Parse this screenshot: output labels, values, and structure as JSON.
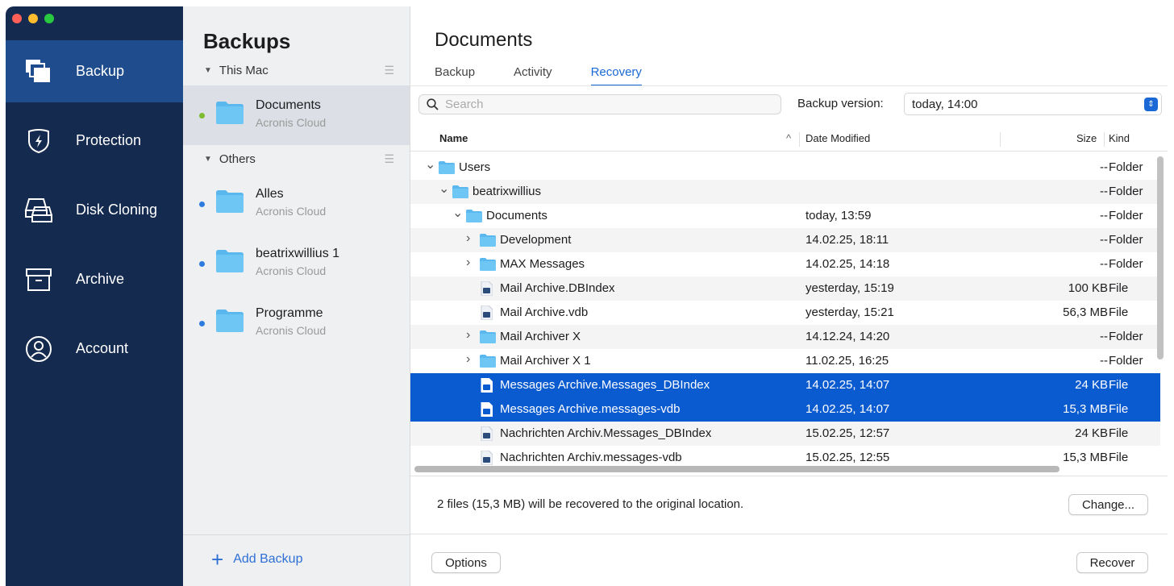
{
  "nav": {
    "items": [
      {
        "label": "Backup",
        "icon": "backup-icon"
      },
      {
        "label": "Protection",
        "icon": "shield-icon"
      },
      {
        "label": "Disk Cloning",
        "icon": "disk-cloning-icon"
      },
      {
        "label": "Archive",
        "icon": "archive-icon"
      },
      {
        "label": "Account",
        "icon": "account-icon"
      }
    ]
  },
  "backups": {
    "title": "Backups",
    "group_this_mac": "This Mac",
    "group_others": "Others",
    "items": [
      {
        "name": "Documents",
        "location": "Acronis Cloud",
        "dot_color": "#7dbb2f"
      },
      {
        "name": "Alles",
        "location": "Acronis Cloud",
        "dot_color": "#2e7be0"
      },
      {
        "name": "beatrixwillius 1",
        "location": "Acronis Cloud",
        "dot_color": "#2e7be0"
      },
      {
        "name": "Programme",
        "location": "Acronis Cloud",
        "dot_color": "#2e7be0"
      }
    ],
    "add_label": "Add Backup"
  },
  "main": {
    "title": "Documents",
    "tabs": [
      "Backup",
      "Activity",
      "Recovery"
    ],
    "active_tab": "Recovery",
    "search_placeholder": "Search",
    "backup_version_label": "Backup version:",
    "backup_version_value": "today, 14:00",
    "columns": {
      "name": "Name",
      "date": "Date Modified",
      "size": "Size",
      "kind": "Kind"
    },
    "rows": [
      {
        "name": "Users",
        "date": "",
        "size": "--",
        "kind": "Folder",
        "type": "folder",
        "chev": "down"
      },
      {
        "name": "beatrixwillius",
        "date": "",
        "size": "--",
        "kind": "Folder",
        "type": "folder",
        "chev": "down"
      },
      {
        "name": "Documents",
        "date": "today, 13:59",
        "size": "--",
        "kind": "Folder",
        "type": "folder",
        "chev": "down"
      },
      {
        "name": "Development",
        "date": "14.02.25, 18:11",
        "size": "--",
        "kind": "Folder",
        "type": "folder",
        "chev": "right"
      },
      {
        "name": "MAX Messages",
        "date": "14.02.25, 14:18",
        "size": "--",
        "kind": "Folder",
        "type": "folder",
        "chev": "right"
      },
      {
        "name": "Mail Archive.DBIndex",
        "date": "yesterday, 15:19",
        "size": "100 KB",
        "kind": "File",
        "type": "file",
        "chev": ""
      },
      {
        "name": "Mail Archive.vdb",
        "date": "yesterday, 15:21",
        "size": "56,3 MB",
        "kind": "File",
        "type": "file",
        "chev": ""
      },
      {
        "name": "Mail Archiver X",
        "date": "14.12.24, 14:20",
        "size": "--",
        "kind": "Folder",
        "type": "folder",
        "chev": "right"
      },
      {
        "name": "Mail Archiver X 1",
        "date": "11.02.25, 16:25",
        "size": "--",
        "kind": "Folder",
        "type": "folder",
        "chev": "right"
      },
      {
        "name": "Messages Archive.Messages_DBIndex",
        "date": "14.02.25, 14:07",
        "size": "24 KB",
        "kind": "File",
        "type": "file",
        "chev": ""
      },
      {
        "name": "Messages Archive.messages-vdb",
        "date": "14.02.25, 14:07",
        "size": "15,3 MB",
        "kind": "File",
        "type": "file",
        "chev": ""
      },
      {
        "name": "Nachrichten Archiv.Messages_DBIndex",
        "date": "15.02.25, 12:57",
        "size": "24 KB",
        "kind": "File",
        "type": "file",
        "chev": ""
      },
      {
        "name": "Nachrichten Archiv.messages-vdb",
        "date": "15.02.25, 12:55",
        "size": "15,3 MB",
        "kind": "File",
        "type": "file",
        "chev": ""
      }
    ],
    "selected_rows": [
      9,
      10
    ],
    "status_text": "2 files (15,3 MB) will be recovered to the original location.",
    "change_label": "Change...",
    "options_label": "Options",
    "recover_label": "Recover"
  },
  "colors": {
    "nav_bg": "#142a4e",
    "nav_active": "#1f4c8c",
    "accent": "#1a68d6",
    "selection": "#0a5ad0",
    "folder": "#5bb8ee"
  }
}
